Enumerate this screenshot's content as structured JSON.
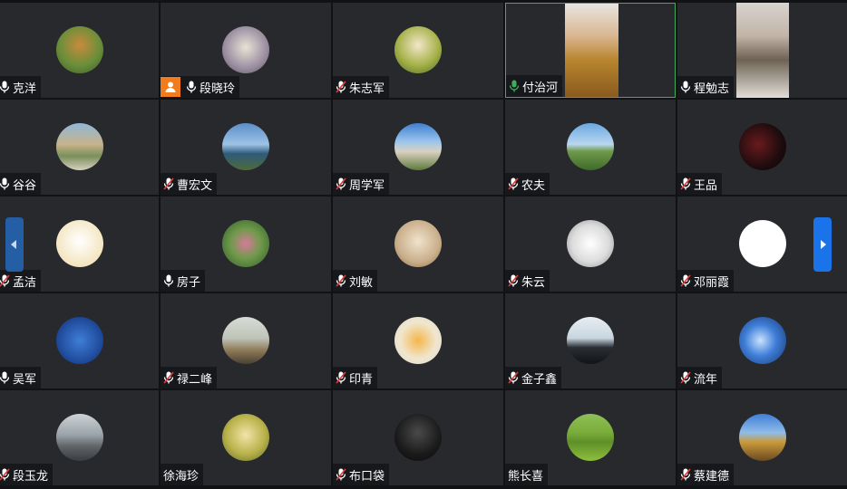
{
  "accent": "#1a73e8",
  "speaking_color": "#3fae5b",
  "host_badge_color": "#f07c1d",
  "nav": {
    "prev_icon": "chevron-left-icon",
    "next_icon": "chevron-right-icon"
  },
  "participants": [
    {
      "name": "克洋",
      "mic": "on",
      "bg": "radial-gradient(circle at 50% 40%,#c88a3c,#6b8f3a 55%,#3d5e2a)"
    },
    {
      "name": "段晓玲",
      "mic": "on",
      "host": true,
      "bg": "radial-gradient(circle at 50% 45%,#e9e2d6,#9a8ea0 60%,#5a5060)"
    },
    {
      "name": "朱志军",
      "mic": "muted",
      "bg": "radial-gradient(circle at 50% 40%,#f3e6c9,#a6b24a 55%,#4f6b20)"
    },
    {
      "name": "付治河",
      "mic": "active",
      "video": true,
      "speaking": true,
      "bg": "linear-gradient(180deg,#e8e6e0 0%,#d9b58f 35%,#b8862f 60%,#8a5a1e 100%)"
    },
    {
      "name": "程勉志",
      "mic": "on",
      "video": true,
      "bg": "linear-gradient(180deg,#d8d3cf 0%,#c2b4a6 35%,#6e6254 60%,#e2ded8 100%)"
    },
    {
      "name": "谷谷",
      "mic": "on",
      "bg": "linear-gradient(180deg,#8fb8d8 0%,#c8b38a 45%,#7a8f5a 70%,#d8cfc0 100%)"
    },
    {
      "name": "曹宏文",
      "mic": "muted",
      "bg": "linear-gradient(180deg,#5b8ec8 0%,#9ec3e6 45%,#2f5a7a 65%,#4e6a3a 100%)"
    },
    {
      "name": "周学军",
      "mic": "muted",
      "bg": "linear-gradient(180deg,#3f7fd0 0%,#9cc6ec 40%,#d9d1c0 60%,#5e7a3d 100%)"
    },
    {
      "name": "农夫",
      "mic": "muted",
      "bg": "linear-gradient(180deg,#6aa8e0 0%,#b9d7ef 45%,#6f9a4a 60%,#3f6a2a 100%)"
    },
    {
      "name": "王品",
      "mic": "muted",
      "bg": "radial-gradient(circle at 40% 45%,#6a1a1e,#1e0c0e 60%,#0b0506)"
    },
    {
      "name": "孟洁",
      "mic": "muted",
      "bg": "radial-gradient(circle at 50% 45%,#ffffff,#f4e9c8 60%,#f0d6a8)"
    },
    {
      "name": "房子",
      "mic": "on",
      "bg": "radial-gradient(circle at 50% 50%,#d67a9a,#6f9a4a 45%,#2f5a2a)"
    },
    {
      "name": "刘敏",
      "mic": "muted",
      "bg": "radial-gradient(circle at 50% 45%,#f0e3cc,#c9ae8a 60%,#8a6a4a)"
    },
    {
      "name": "朱云",
      "mic": "muted",
      "bg": "radial-gradient(circle at 50% 50%,#ffffff,#dcdcdc 55%,#8a8a8a)"
    },
    {
      "name": "邓丽霞",
      "mic": "muted",
      "bg": "radial-gradient(circle at 50% 50%,#ffffff,#ffffff 65%,#e8e8e8)"
    },
    {
      "name": "吴军",
      "mic": "on",
      "bg": "radial-gradient(circle at 50% 50%,#3f7ed8,#1f4a9a 65%,#102a66)"
    },
    {
      "name": "禄二峰",
      "mic": "muted",
      "bg": "linear-gradient(180deg,#d7dcd6 0%,#bfc4b9 45%,#8f7c5a 70%,#4a4032 100%)"
    },
    {
      "name": "印青",
      "mic": "muted",
      "bg": "radial-gradient(circle at 50% 50%,#f5b64a,#f0e6cf 55%,#dedad0)"
    },
    {
      "name": "金子鑫",
      "mic": "muted",
      "bg": "linear-gradient(180deg,#e7edf2 0%,#c9d6e0 45%,#2a2e33 65%,#121416 100%)"
    },
    {
      "name": "流年",
      "mic": "muted",
      "bg": "radial-gradient(circle at 45% 50%,#c9e2ff,#3f7ed8 45%,#17356e)"
    },
    {
      "name": "段玉龙",
      "mic": "muted",
      "bg": "linear-gradient(180deg,#cdd3d8 0%,#9aa3a8 45%,#5e6266 70%,#3a3d40 100%)"
    },
    {
      "name": "徐海珍",
      "mic": "none",
      "bg": "radial-gradient(circle at 50% 45%,#f2e4a8,#b9b14a 55%,#5a6a2a)"
    },
    {
      "name": "布口袋",
      "mic": "muted",
      "bg": "radial-gradient(circle at 50% 40%,#4a4a4a,#1a1a1a 60%,#0a0a0a)"
    },
    {
      "name": "熊长喜",
      "mic": "none",
      "bg": "linear-gradient(180deg,#8fbf58 0%,#7aac3a 40%,#5e8f2a 60%,#8fbf3a 100%)"
    },
    {
      "name": "蔡建德",
      "mic": "muted",
      "bg": "linear-gradient(180deg,#3f7ed8 0%,#8fbce8 40%,#c99a3a 60%,#6a4a22 100%)"
    }
  ]
}
